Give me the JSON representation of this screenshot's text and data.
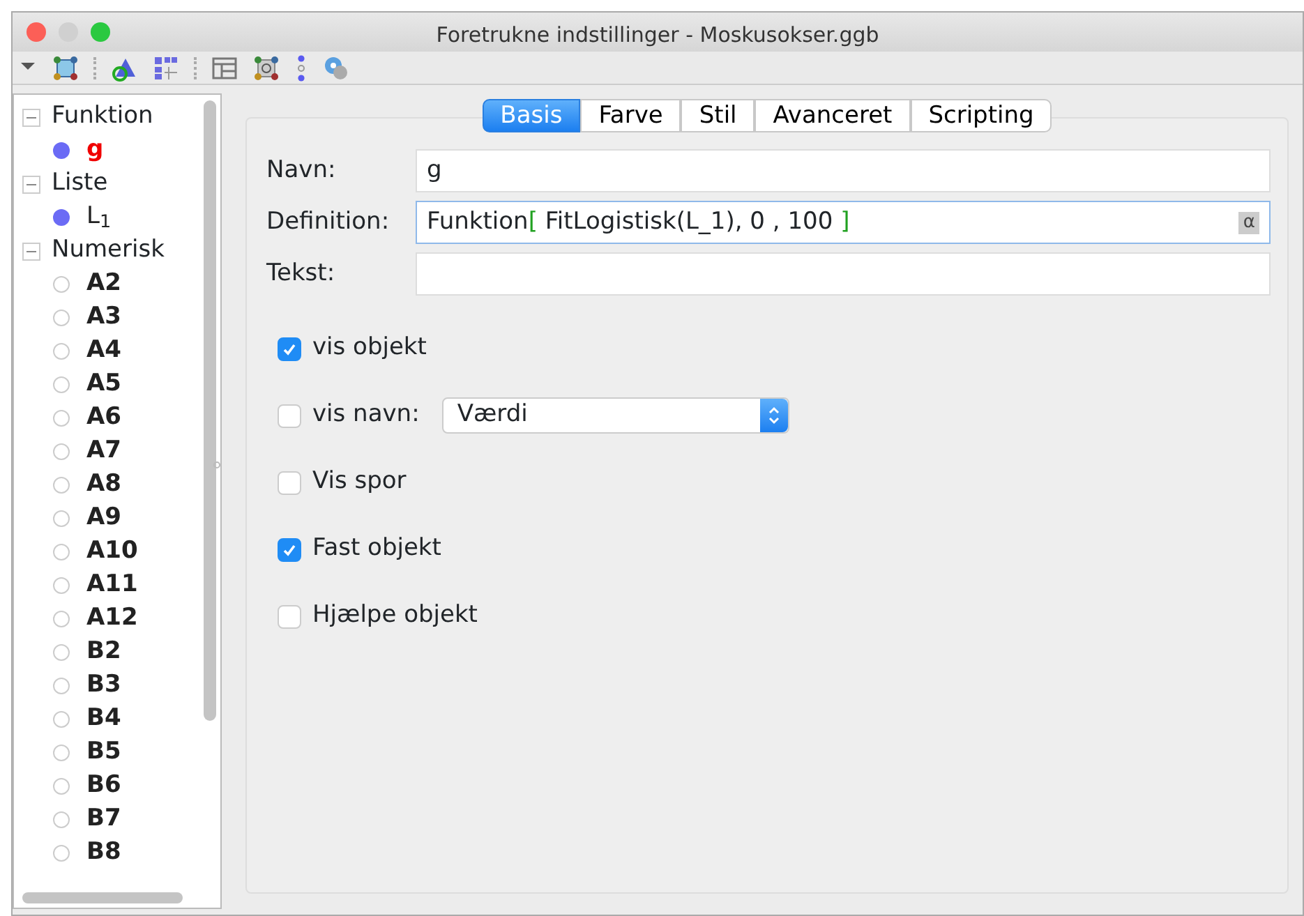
{
  "window": {
    "title": "Foretrukne indstillinger - Moskusokser.ggb"
  },
  "toolbar": {
    "items": [
      {
        "kind": "dropdown"
      },
      {
        "kind": "point"
      },
      {
        "kind": "separator"
      },
      {
        "kind": "shape"
      },
      {
        "kind": "grid"
      },
      {
        "kind": "separator"
      },
      {
        "kind": "layout"
      },
      {
        "kind": "frame"
      },
      {
        "kind": "dots"
      },
      {
        "kind": "gears"
      }
    ]
  },
  "tree": [
    {
      "label": "Funktion",
      "expanded": true,
      "children": [
        {
          "label": "g",
          "visible": true,
          "selected": true
        }
      ]
    },
    {
      "label": "Liste",
      "expanded": true,
      "children": [
        {
          "label": "L$_{1}$",
          "visible": true,
          "selected": false
        }
      ]
    },
    {
      "label": "Numerisk",
      "expanded": true,
      "children": [
        {
          "label": "A2",
          "visible": false,
          "selected": false
        },
        {
          "label": "A3",
          "visible": false,
          "selected": false
        },
        {
          "label": "A4",
          "visible": false,
          "selected": false
        },
        {
          "label": "A5",
          "visible": false,
          "selected": false
        },
        {
          "label": "A6",
          "visible": false,
          "selected": false
        },
        {
          "label": "A7",
          "visible": false,
          "selected": false
        },
        {
          "label": "A8",
          "visible": false,
          "selected": false
        },
        {
          "label": "A9",
          "visible": false,
          "selected": false
        },
        {
          "label": "A10",
          "visible": false,
          "selected": false
        },
        {
          "label": "A11",
          "visible": false,
          "selected": false
        },
        {
          "label": "A12",
          "visible": false,
          "selected": false
        },
        {
          "label": "B2",
          "visible": false,
          "selected": false
        },
        {
          "label": "B3",
          "visible": false,
          "selected": false
        },
        {
          "label": "B4",
          "visible": false,
          "selected": false
        },
        {
          "label": "B5",
          "visible": false,
          "selected": false
        },
        {
          "label": "B6",
          "visible": false,
          "selected": false
        },
        {
          "label": "B7",
          "visible": false,
          "selected": false
        },
        {
          "label": "B8",
          "visible": false,
          "selected": false
        }
      ]
    }
  ],
  "tabs": [
    {
      "label": "Basis",
      "selected": true
    },
    {
      "label": "Farve",
      "selected": false
    },
    {
      "label": "Stil",
      "selected": false
    },
    {
      "label": "Avanceret",
      "selected": false
    },
    {
      "label": "Scripting",
      "selected": false
    }
  ],
  "fields": [
    {
      "label": "Navn:",
      "segments": [
        {
          "kind": "plain",
          "text": "g"
        }
      ]
    },
    {
      "label": "Definition:",
      "focused": true,
      "symbol_button": "α",
      "segments": [
        {
          "kind": "plain",
          "text": "Funktion"
        },
        {
          "kind": "bracket",
          "text": "["
        },
        {
          "kind": "plain",
          "text": " FitLogistisk(L_1), 0 , 100 "
        },
        {
          "kind": "bracket",
          "text": "]"
        }
      ]
    },
    {
      "label": "Tekst:"
    }
  ],
  "options": [
    {
      "label": "vis objekt",
      "checked": true
    },
    {
      "label": "vis navn:",
      "checked": false,
      "select": {
        "value": "Værdi"
      }
    },
    {
      "label": "Vis spor",
      "checked": false
    },
    {
      "label": "Fast objekt",
      "checked": true
    },
    {
      "label": "Hjælpe objekt",
      "checked": false
    }
  ]
}
